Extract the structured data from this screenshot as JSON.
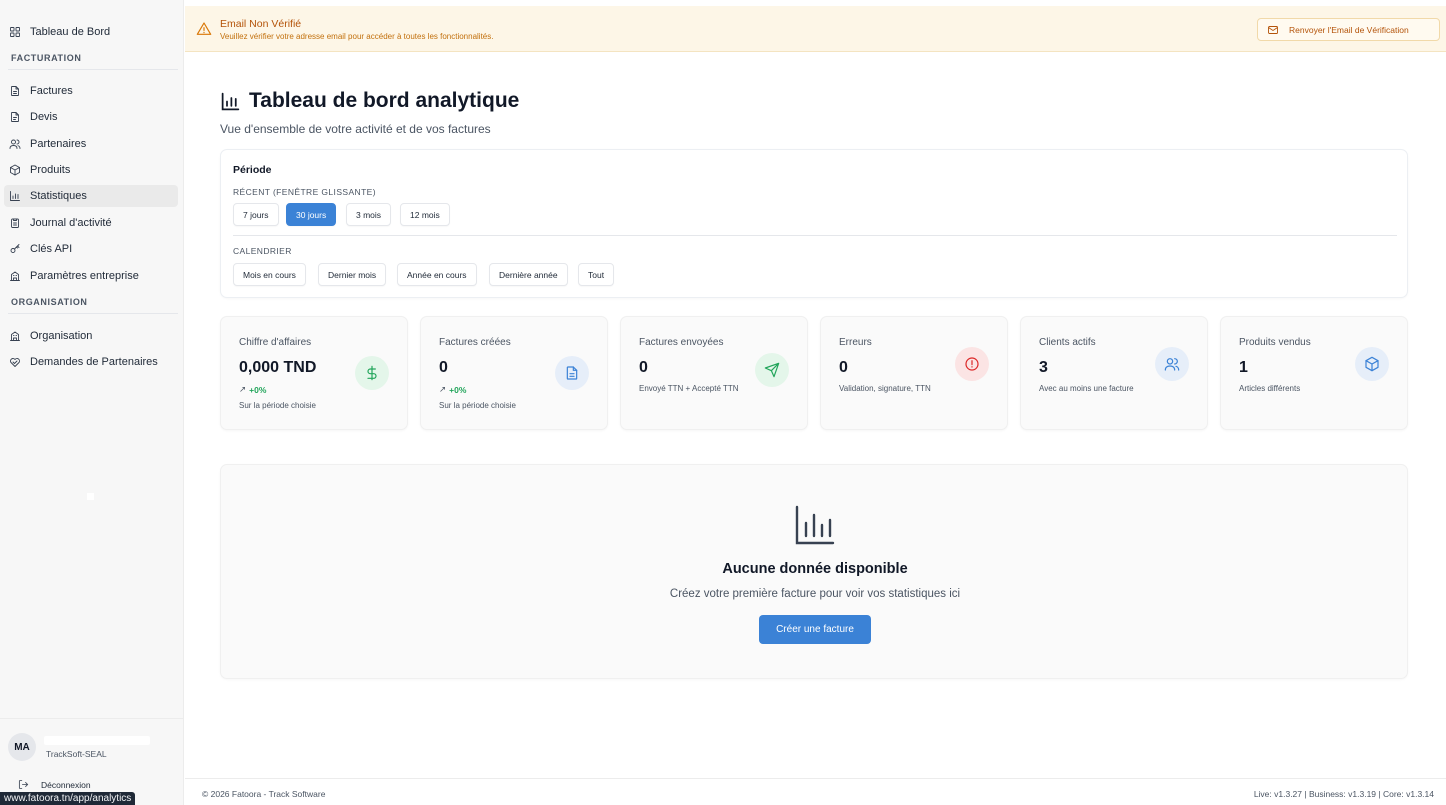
{
  "sidebar": {
    "items": [
      {
        "label": "Tableau de Bord",
        "icon": "dashboard-icon"
      },
      {
        "label": "Factures",
        "icon": "invoice-icon"
      },
      {
        "label": "Devis",
        "icon": "quote-icon"
      },
      {
        "label": "Partenaires",
        "icon": "partners-icon"
      },
      {
        "label": "Produits",
        "icon": "package-icon"
      },
      {
        "label": "Statistiques",
        "icon": "chart-icon"
      },
      {
        "label": "Journal d'activité",
        "icon": "clipboard-icon"
      },
      {
        "label": "Clés API",
        "icon": "key-icon"
      },
      {
        "label": "Paramètres entreprise",
        "icon": "building-icon"
      },
      {
        "label": "Organisation",
        "icon": "building-icon"
      },
      {
        "label": "Demandes de Partenaires",
        "icon": "handshake-icon"
      }
    ],
    "sections": {
      "billing": "FACTURATION",
      "organization": "ORGANISATION"
    },
    "active_item": "Statistiques",
    "user": {
      "initials": "MA",
      "org": "TrackSoft-SEAL"
    },
    "logout_label": "Déconnexion"
  },
  "status_url": "www.fatoora.tn/app/analytics",
  "banner": {
    "title": "Email Non Vérifié",
    "text": "Veuillez vérifier votre adresse email pour accéder à toutes les fonctionnalités.",
    "button_label": "Renvoyer l'Email de Vérification",
    "color": "#d97706"
  },
  "header": {
    "title": "Tableau de bord analytique",
    "subtitle": "Vue d'ensemble de votre activité et de vos factures"
  },
  "period": {
    "title": "Période",
    "recent_label": "RÉCENT (FENÊTRE GLISSANTE)",
    "recent_options": [
      "7 jours",
      "30 jours",
      "3 mois",
      "12 mois"
    ],
    "selected": "30 jours",
    "calendar_label": "CALENDRIER",
    "calendar_options": [
      "Mois en cours",
      "Dernier mois",
      "Année en cours",
      "Dernière année",
      "Tout"
    ]
  },
  "stats": [
    {
      "label": "Chiffre d'affaires",
      "value": "0,000 TND",
      "trend": "+0%",
      "desc": "Sur la période choisie",
      "icon": "dollar-icon",
      "color": "#22a55b"
    },
    {
      "label": "Factures créées",
      "value": "0",
      "trend": "+0%",
      "desc": "Sur la période choisie",
      "icon": "file-icon",
      "color": "#3b82d6"
    },
    {
      "label": "Factures envoyées",
      "value": "0",
      "trend": "",
      "desc": "Envoyé TTN + Accepté TTN",
      "icon": "send-icon",
      "color": "#22a55b"
    },
    {
      "label": "Erreurs",
      "value": "0",
      "trend": "",
      "desc": "Validation, signature, TTN",
      "icon": "alert-icon",
      "color": "#dc2626"
    },
    {
      "label": "Clients actifs",
      "value": "3",
      "trend": "",
      "desc": "Avec au moins une facture",
      "icon": "users-icon",
      "color": "#3b82d6"
    },
    {
      "label": "Produits vendus",
      "value": "1",
      "trend": "",
      "desc": "Articles différents",
      "icon": "box-icon",
      "color": "#3b82d6"
    }
  ],
  "empty_state": {
    "title": "Aucune donnée disponible",
    "text": "Créez votre première facture pour voir vos statistiques ici",
    "button_label": "Créer une facture"
  },
  "footer": {
    "copyright": "© 2026 Fatoora - Track Software",
    "versions": "Live: v1.3.27 | Business: v1.3.19 | Core: v1.3.14"
  },
  "colors": {
    "accent": "#3b82d6",
    "success": "#22a55b",
    "danger": "#dc2626",
    "warning": "#d97706"
  }
}
